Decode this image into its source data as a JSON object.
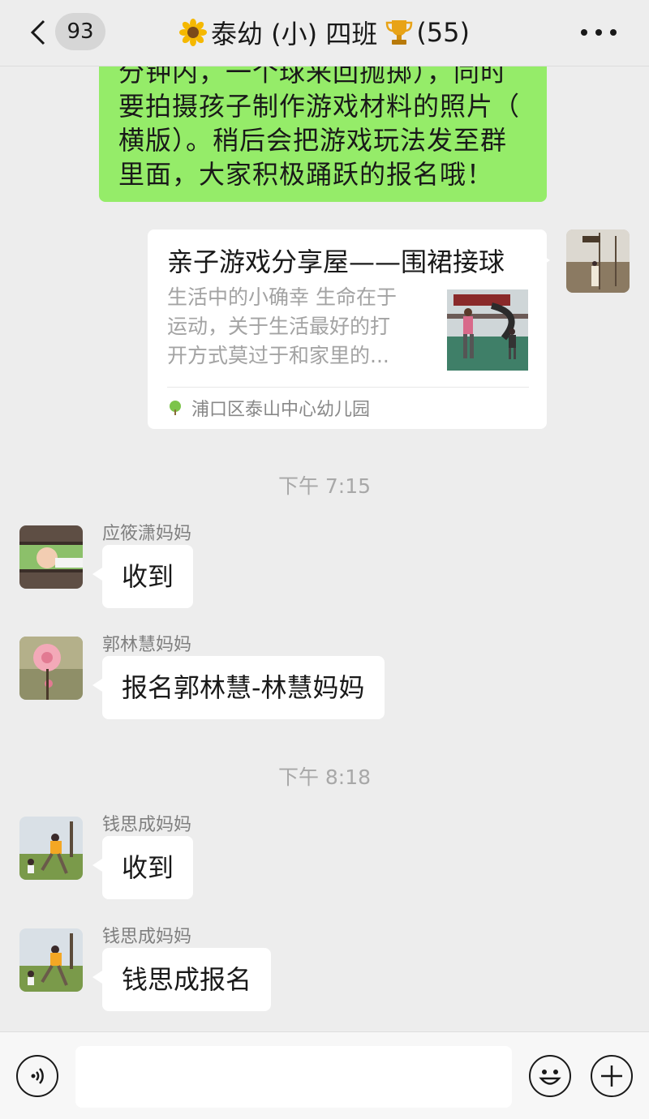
{
  "header": {
    "back_icon": "chevron-left-icon",
    "unread_count": "93",
    "title_icon": "sunflower-icon",
    "title_text": "泰幼 (小) 四班",
    "trophy_icon": "trophy-icon",
    "member_count": "(55)",
    "more_icon": "more-dots-icon"
  },
  "messages": {
    "partial_own": {
      "lines": [
        "分钟内，一个球来回抛掷），同时",
        "要拍摄孩子制作游戏材料的照片（",
        "横版）。稍后会把游戏玩法发至群",
        "里面，大家积极踊跃的报名哦！"
      ],
      "bubble_color": "#95ec69"
    },
    "shared_card": {
      "title": "亲子游戏分享屋——围裙接球",
      "desc_lines": [
        "生活中的小确幸  生命在于",
        "运动，关于生活最好的打",
        "开方式莫过于和家里的..."
      ],
      "source": "浦口区泰山中心幼儿园"
    },
    "time1": "下午 7:15",
    "msg1": {
      "nickname": "应筱潇妈妈",
      "text": "收到"
    },
    "msg2": {
      "nickname": "郭林慧妈妈",
      "text": "报名郭林慧-林慧妈妈"
    },
    "time2": "下午 8:18",
    "msg3": {
      "nickname": "钱思成妈妈",
      "text": "收到"
    },
    "msg4": {
      "nickname": "钱思成妈妈",
      "text": "钱思成报名"
    }
  },
  "input_bar": {
    "voice_icon": "voice-icon",
    "emoji_icon": "emoji-icon",
    "plus_icon": "plus-icon",
    "input_value": ""
  },
  "colors": {
    "background": "#ededed",
    "own_bubble": "#95ec69",
    "other_bubble": "#ffffff",
    "timestamp": "#a8a8a8"
  }
}
